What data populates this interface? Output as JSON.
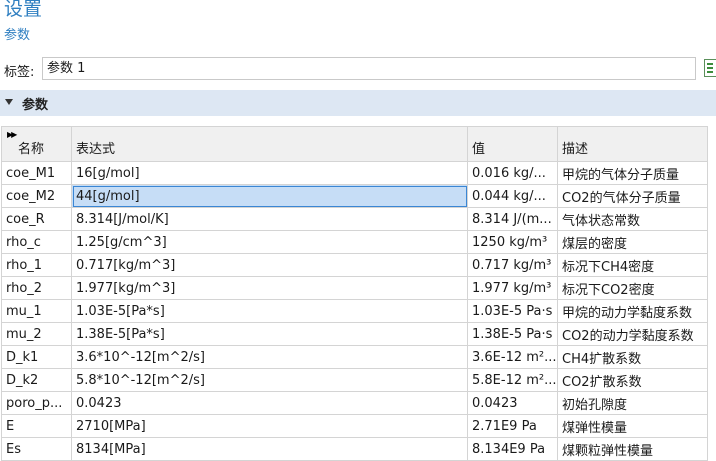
{
  "header": {
    "title": "设置",
    "subtitle": "参数"
  },
  "label_field": {
    "label": "标签:",
    "value": "参数 1",
    "icon": "list-icon"
  },
  "section": {
    "label": "参数"
  },
  "table": {
    "columns": [
      "名称",
      "表达式",
      "值",
      "描述"
    ],
    "rows": [
      {
        "name": "coe_M1",
        "expr": "16[g/mol]",
        "value": "0.016 kg/...",
        "desc": "甲烷的气体分子质量"
      },
      {
        "name": "coe_M2",
        "expr": "44[g/mol]",
        "value": "0.044 kg/...",
        "desc": "CO2的气体分子质量"
      },
      {
        "name": "coe_R",
        "expr": "8.314[J/mol/K]",
        "value": "8.314 J/(m...",
        "desc": "气体状态常数"
      },
      {
        "name": "rho_c",
        "expr": "1.25[g/cm^3]",
        "value": "1250 kg/m³",
        "desc": "煤层的密度"
      },
      {
        "name": "rho_1",
        "expr": "0.717[kg/m^3]",
        "value": "0.717 kg/m³",
        "desc": "标况下CH4密度"
      },
      {
        "name": "rho_2",
        "expr": "1.977[kg/m^3]",
        "value": "1.977 kg/m³",
        "desc": "标况下CO2密度"
      },
      {
        "name": "mu_1",
        "expr": "1.03E-5[Pa*s]",
        "value": "1.03E-5 Pa·s",
        "desc": "甲烷的动力学黏度系数"
      },
      {
        "name": "mu_2",
        "expr": "1.38E-5[Pa*s]",
        "value": "1.38E-5 Pa·s",
        "desc": "CO2的动力学黏度系数"
      },
      {
        "name": "D_k1",
        "expr": "3.6*10^-12[m^2/s]",
        "value": "3.6E-12 m²...",
        "desc": "CH4扩散系数"
      },
      {
        "name": "D_k2",
        "expr": "5.8*10^-12[m^2/s]",
        "value": "5.8E-12 m²...",
        "desc": "CO2扩散系数"
      },
      {
        "name": "poro_p...",
        "expr": "0.0423",
        "value": "0.0423",
        "desc": "初始孔隙度"
      },
      {
        "name": "E",
        "expr": "2710[MPa]",
        "value": "2.71E9 Pa",
        "desc": "煤弹性模量"
      },
      {
        "name": "Es",
        "expr": "8134[MPa]",
        "value": "8.134E9 Pa",
        "desc": "煤颗粒弹性模量"
      }
    ]
  },
  "colors": {
    "accent": "#2f7fc1",
    "section_bg": "#dde7f3",
    "selection": "#c6ddf6"
  }
}
